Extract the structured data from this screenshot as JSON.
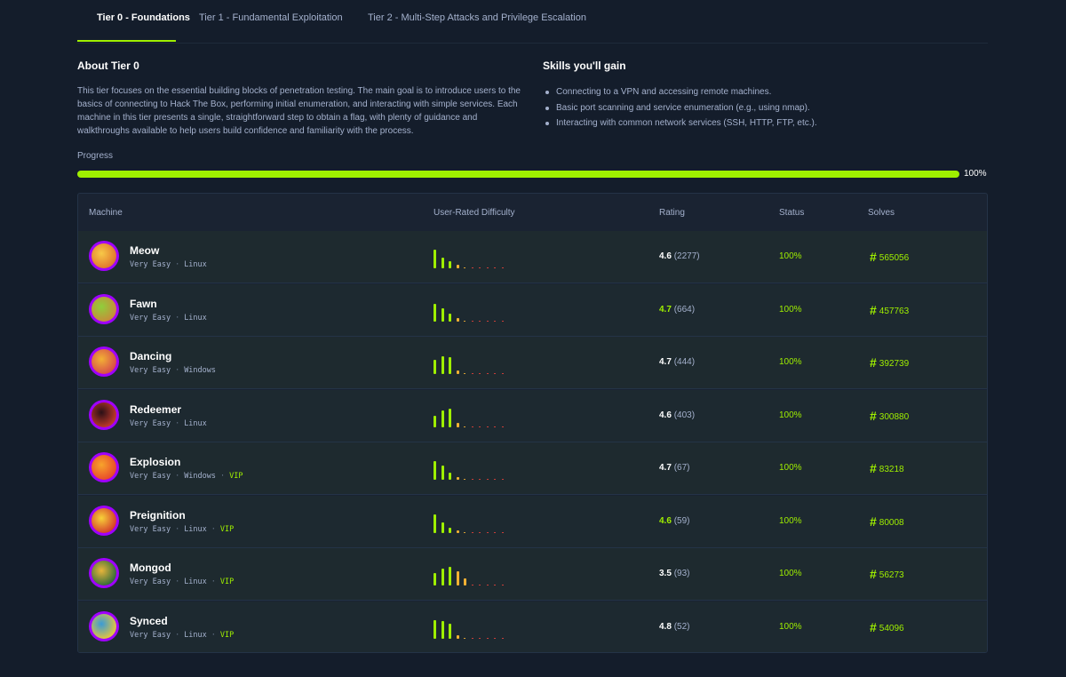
{
  "tabs": [
    {
      "label": "Tier 0 - Foundations",
      "active": true
    },
    {
      "label": "Tier 1 - Fundamental Exploitation",
      "active": false
    },
    {
      "label": "Tier 2 - Multi-Step Attacks and Privilege Escalation",
      "active": false
    }
  ],
  "about": {
    "title": "About Tier 0",
    "description": "This tier focuses on the essential building blocks of penetration testing. The main goal is to introduce users to the basics of connecting to Hack The Box, performing initial enumeration, and interacting with simple services. Each machine in this tier presents a single, straightforward step to obtain a flag, with plenty of guidance and walkthroughs available to help users build confidence and familiarity with the process."
  },
  "skills": {
    "title": "Skills you'll gain",
    "items": [
      "Connecting to a VPN and accessing remote machines.",
      "Basic port scanning and service enumeration (e.g., using nmap).",
      "Interacting with common network services (SSH, HTTP, FTP, etc.)."
    ]
  },
  "progress": {
    "label": "Progress",
    "value": 1.0,
    "text": "100%"
  },
  "table": {
    "headers": {
      "machine": "Machine",
      "difficulty": "User-Rated Difficulty",
      "rating": "Rating",
      "status": "Status",
      "solves": "Solves"
    },
    "rows": [
      {
        "name": "Meow",
        "difficulty": "Very Easy",
        "os": "Linux",
        "vip": "",
        "rating": "4.6",
        "rating_green": false,
        "rating_count": "(2277)",
        "status": "100%",
        "solves": "565056",
        "bars": [
          21,
          12,
          8,
          4,
          1,
          1,
          1,
          1,
          1,
          1
        ],
        "avatar_colors": [
          "#f7c948",
          "#e0742b"
        ]
      },
      {
        "name": "Fawn",
        "difficulty": "Very Easy",
        "os": "Linux",
        "vip": "",
        "rating": "4.7",
        "rating_green": true,
        "rating_count": "(664)",
        "status": "100%",
        "solves": "457763",
        "bars": [
          20,
          15,
          9,
          4,
          1,
          1,
          1,
          1,
          1,
          1
        ],
        "avatar_colors": [
          "#8fcf3b",
          "#c98a3a"
        ]
      },
      {
        "name": "Dancing",
        "difficulty": "Very Easy",
        "os": "Windows",
        "vip": "",
        "rating": "4.7",
        "rating_green": false,
        "rating_count": "(444)",
        "status": "100%",
        "solves": "392739",
        "bars": [
          16,
          20,
          19,
          4,
          1,
          1,
          1,
          1,
          1,
          1
        ],
        "avatar_colors": [
          "#f2b134",
          "#d64a4a"
        ]
      },
      {
        "name": "Redeemer",
        "difficulty": "Very Easy",
        "os": "Linux",
        "vip": "",
        "rating": "4.6",
        "rating_green": false,
        "rating_count": "(403)",
        "status": "100%",
        "solves": "300880",
        "bars": [
          13,
          19,
          21,
          5,
          1,
          1,
          1,
          1,
          1,
          1
        ],
        "avatar_colors": [
          "#2a1016",
          "#c43a2a"
        ]
      },
      {
        "name": "Explosion",
        "difficulty": "Very Easy",
        "os": "Windows",
        "vip": "VIP",
        "rating": "4.7",
        "rating_green": false,
        "rating_count": "(67)",
        "status": "100%",
        "solves": "83218",
        "bars": [
          21,
          16,
          8,
          3,
          1,
          1,
          1,
          1,
          1,
          1
        ],
        "avatar_colors": [
          "#f7a42b",
          "#e8482a"
        ]
      },
      {
        "name": "Preignition",
        "difficulty": "Very Easy",
        "os": "Linux",
        "vip": "VIP",
        "rating": "4.6",
        "rating_green": true,
        "rating_count": "(59)",
        "status": "100%",
        "solves": "80008",
        "bars": [
          21,
          12,
          6,
          3,
          1,
          1,
          1,
          1,
          1,
          1
        ],
        "avatar_colors": [
          "#f7d238",
          "#d43a2a"
        ]
      },
      {
        "name": "Mongod",
        "difficulty": "Very Easy",
        "os": "Linux",
        "vip": "VIP",
        "rating": "3.5",
        "rating_green": false,
        "rating_count": "(93)",
        "status": "100%",
        "solves": "56273",
        "bars": [
          14,
          19,
          21,
          16,
          8,
          1,
          1,
          1,
          1,
          1
        ],
        "avatar_colors": [
          "#e8b53a",
          "#2f6a3a"
        ]
      },
      {
        "name": "Synced",
        "difficulty": "Very Easy",
        "os": "Linux",
        "vip": "VIP",
        "rating": "4.8",
        "rating_green": false,
        "rating_count": "(52)",
        "status": "100%",
        "solves": "54096",
        "bars": [
          21,
          20,
          17,
          4,
          1,
          1,
          1,
          1,
          1,
          1
        ],
        "avatar_colors": [
          "#3a9bd6",
          "#e8c53a"
        ]
      }
    ]
  },
  "colors": {
    "accent": "#9fef00",
    "bar_mid": "#f2b134",
    "bar_low": "#e2423a",
    "background": "#141d2b"
  }
}
